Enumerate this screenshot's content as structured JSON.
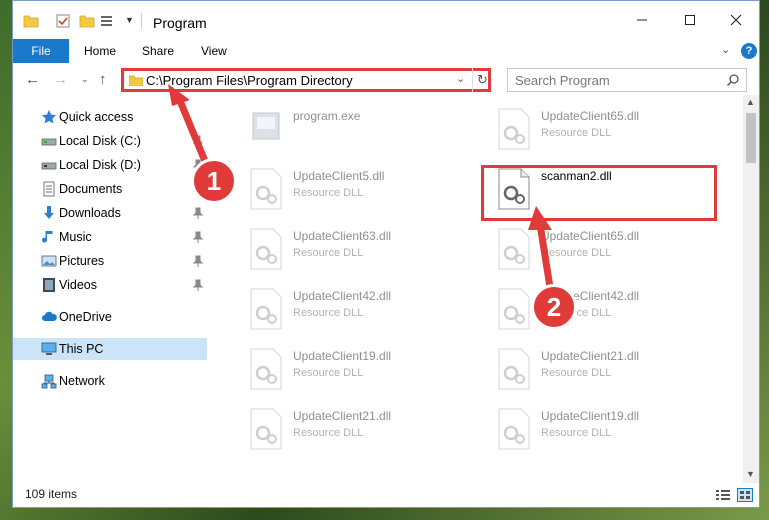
{
  "window": {
    "title": "Program",
    "minimize_icon": "minimize-icon",
    "maximize_icon": "maximize-icon",
    "close_icon": "close-icon"
  },
  "ribbon": {
    "tabs": [
      {
        "label": "File",
        "active": true
      },
      {
        "label": "Home"
      },
      {
        "label": "Share"
      },
      {
        "label": "View"
      }
    ]
  },
  "nav": {
    "address": "C:\\Program Files\\Program Directory",
    "search_placeholder": "Search Program"
  },
  "sidebar": {
    "items": [
      {
        "label": "Quick access",
        "icon": "star-icon",
        "pinned": false
      },
      {
        "label": "Local Disk (C:)",
        "icon": "drive-icon",
        "pinned": true
      },
      {
        "label": "Local Disk (D:)",
        "icon": "drive-icon",
        "pinned": true
      },
      {
        "label": "Documents",
        "icon": "documents-icon",
        "pinned": true
      },
      {
        "label": "Downloads",
        "icon": "download-icon",
        "pinned": true
      },
      {
        "label": "Music",
        "icon": "music-icon",
        "pinned": true
      },
      {
        "label": "Pictures",
        "icon": "pictures-icon",
        "pinned": true
      },
      {
        "label": "Videos",
        "icon": "videos-icon",
        "pinned": true
      },
      {
        "label": "OneDrive",
        "icon": "cloud-icon",
        "pinned": false
      },
      {
        "label": "This PC",
        "icon": "computer-icon",
        "pinned": false,
        "selected": true
      },
      {
        "label": "Network",
        "icon": "network-icon",
        "pinned": false
      }
    ]
  },
  "files": [
    {
      "name": "program.exe",
      "type": ""
    },
    {
      "name": "UpdateClient65.dll",
      "type": "Resource DLL"
    },
    {
      "name": "UpdateClient5.dll",
      "type": "Resource DLL"
    },
    {
      "name": "scanman2.dll",
      "type": "",
      "highlighted": true
    },
    {
      "name": "UpdateClient63.dll",
      "type": "Resource DLL"
    },
    {
      "name": "UpdateClient65.dll",
      "type": "Resource DLL"
    },
    {
      "name": "UpdateClient42.dll",
      "type": "Resource DLL"
    },
    {
      "name": "UpdateClient42.dll",
      "type": "Resource DLL"
    },
    {
      "name": "UpdateClient19.dll",
      "type": "Resource DLL"
    },
    {
      "name": "UpdateClient21.dll",
      "type": "Resource DLL"
    },
    {
      "name": "UpdateClient21.dll",
      "type": "Resource DLL"
    },
    {
      "name": "UpdateClient19.dll",
      "type": "Resource DLL"
    }
  ],
  "status": {
    "item_count": "109 items"
  },
  "callouts": [
    {
      "number": "1"
    },
    {
      "number": "2"
    }
  ],
  "colors": {
    "accent": "#1979ca",
    "callout": "#e03a3a",
    "selected_bg": "#cce4f7"
  }
}
